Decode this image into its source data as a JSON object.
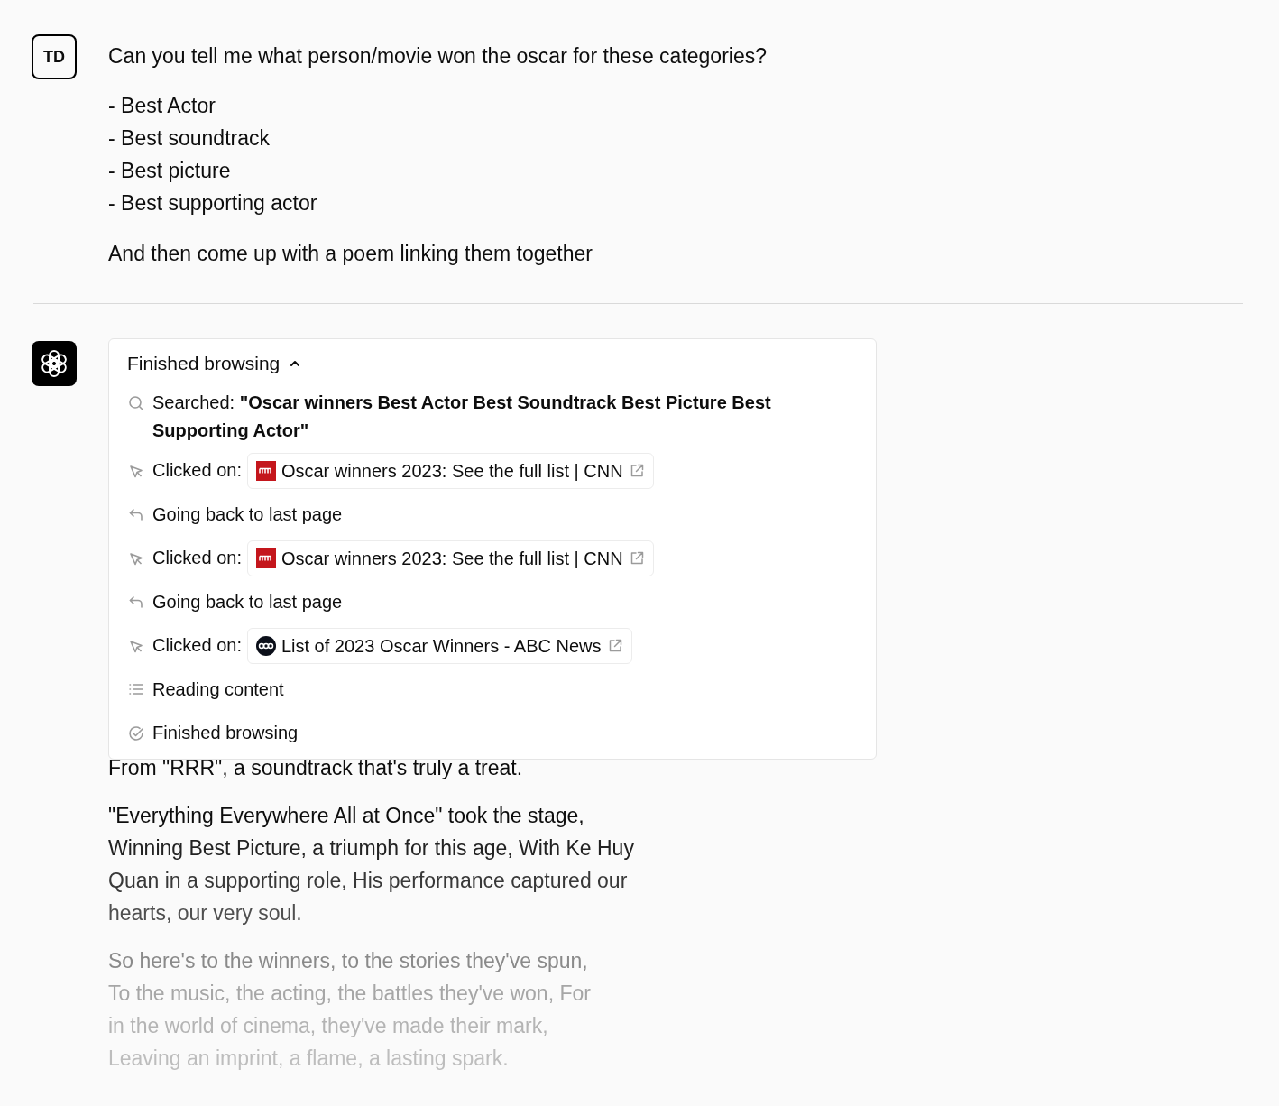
{
  "user_message": {
    "avatar": "TD",
    "intro": "Can you tell me what person/movie won the oscar for these categories?",
    "list": [
      "- Best Actor",
      "- Best soundtrack",
      "- Best picture",
      "- Best supporting actor"
    ],
    "closing": "And then come up with a poem linking them together"
  },
  "assistant_message": {
    "browsing": {
      "title": "Finished browsing",
      "expanded": true,
      "steps": [
        {
          "kind": "search",
          "label": "Searched:",
          "query": "\"Oscar winners Best Actor Best Soundtrack Best Picture Best Supporting Actor\""
        },
        {
          "kind": "click",
          "label": "Clicked on:",
          "link": {
            "kind": "square",
            "title": "Oscar winners 2023: See the full list | CNN"
          }
        },
        {
          "kind": "back",
          "label": "Going back to last page"
        },
        {
          "kind": "click",
          "label": "Clicked on:",
          "link": {
            "kind": "square",
            "title": "Oscar winners 2023: See the full list | CNN"
          }
        },
        {
          "kind": "back",
          "label": "Going back to last page"
        },
        {
          "kind": "click",
          "label": "Clicked on:",
          "link": {
            "kind": "circle",
            "title": "List of 2023 Oscar Winners - ABC News"
          }
        },
        {
          "kind": "read",
          "label": "Reading content"
        },
        {
          "kind": "done",
          "label": "Finished browsing"
        }
      ]
    },
    "poem": [
      [
        {
          "text": "From \"RRR\", a soundtrack that's truly a treat.",
          "color": "#0d0d0d"
        }
      ],
      [
        {
          "text": "\"Everything Everywhere All at Once\" took the stage,",
          "color": "#0d0d0d"
        },
        {
          "text": "Winning Best Picture, a triumph for this age, With Ke Huy",
          "color": "#222222"
        },
        {
          "text": "Quan in a supporting role, His performance captured our",
          "color": "#383838"
        },
        {
          "text": "hearts, our very soul.",
          "color": "#4f4f4f"
        }
      ],
      [
        {
          "text": "So here's to the winners, to the stories they've spun,",
          "color": "#8a8a8a"
        },
        {
          "text": "To the music, the acting, the battles they've won, For",
          "color": "#a6a6a6"
        },
        {
          "text": "in the world of cinema, they've made their mark,",
          "color": "#b4b4b4"
        },
        {
          "text": "Leaving an imprint, a flame, a lasting spark.",
          "color": "#bdbdbd"
        }
      ]
    ]
  }
}
